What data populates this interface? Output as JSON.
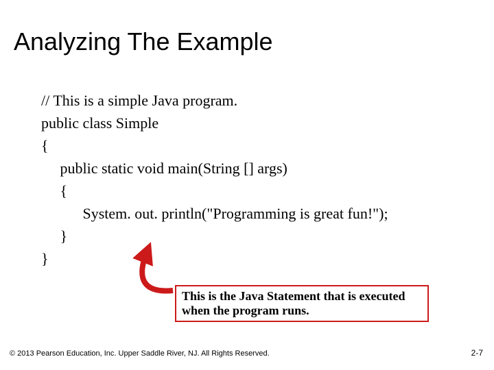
{
  "title": "Analyzing The Example",
  "code": {
    "l1": "// This is a simple Java program.",
    "l2": "",
    "l3": "public class Simple",
    "l4": "{",
    "l5": "     public static void main(String [] args)",
    "l6": "     {",
    "l7": "           System. out. println(\"Programming is great fun!\");",
    "l8": "     }",
    "l9": "}"
  },
  "callout": "This is the Java Statement that is executed when the program runs.",
  "footer_left": "© 2013 Pearson Education, Inc. Upper Saddle River, NJ. All Rights Reserved.",
  "footer_right": "2-7"
}
